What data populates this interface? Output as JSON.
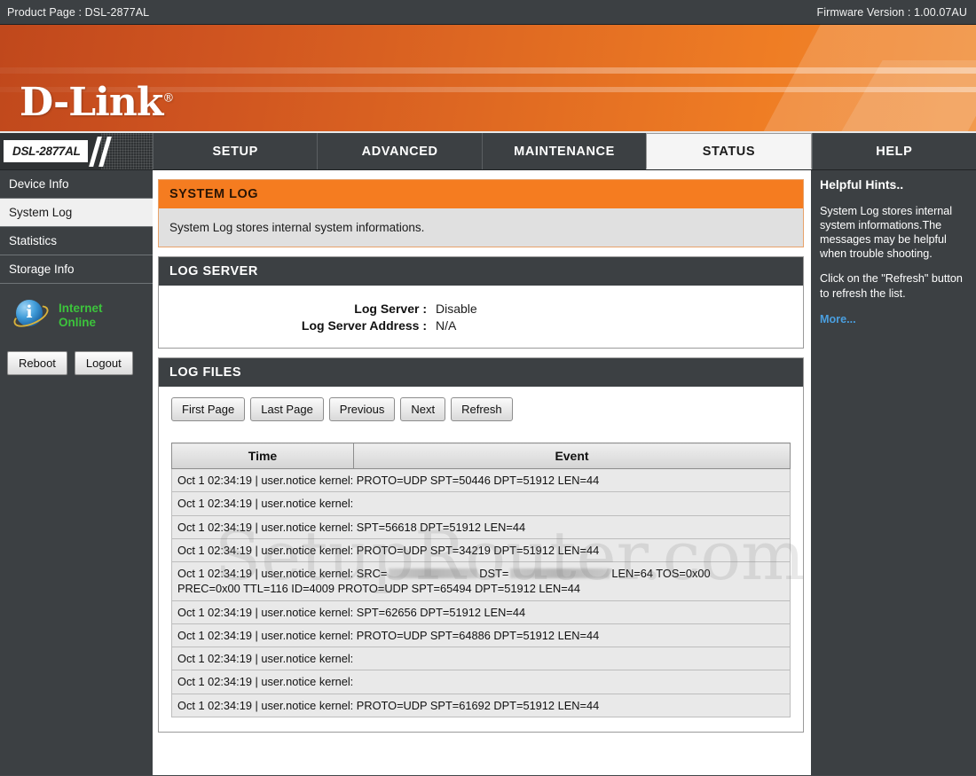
{
  "topbar": {
    "product_page": "Product Page : DSL-2877AL",
    "firmware": "Firmware Version :  1.00.07AU"
  },
  "brand": {
    "logo": "D-Link",
    "registered": "®"
  },
  "nav": {
    "model": "DSL-2877AL",
    "tabs": [
      {
        "label": "SETUP",
        "active": false
      },
      {
        "label": "ADVANCED",
        "active": false
      },
      {
        "label": "MAINTENANCE",
        "active": false
      },
      {
        "label": "STATUS",
        "active": true
      },
      {
        "label": "HELP",
        "active": false
      }
    ]
  },
  "sidebar": {
    "items": [
      {
        "label": "Device Info",
        "active": false
      },
      {
        "label": "System Log",
        "active": true
      },
      {
        "label": "Statistics",
        "active": false
      },
      {
        "label": "Storage Info",
        "active": false
      }
    ],
    "status": {
      "line1": "Internet",
      "line2": "Online",
      "icon": "internet-globe-icon"
    },
    "buttons": {
      "reboot": "Reboot",
      "logout": "Logout"
    }
  },
  "main": {
    "system_log": {
      "title": "SYSTEM LOG",
      "description": "System Log stores internal system informations."
    },
    "log_server": {
      "title": "LOG SERVER",
      "rows": [
        {
          "key": "Log Server :",
          "value": "Disable"
        },
        {
          "key": "Log Server Address :",
          "value": "N/A"
        }
      ]
    },
    "log_files": {
      "title": "LOG FILES",
      "buttons": [
        "First Page",
        "Last Page",
        "Previous",
        "Next",
        "Refresh"
      ],
      "columns": [
        "Time",
        "Event"
      ],
      "rows": [
        {
          "text": "Oct 1 02:34:19 | user.notice kernel: PROTO=UDP SPT=50446 DPT=51912 LEN=44",
          "redacted": false
        },
        {
          "text": "Oct 1 02:34:19 | user.notice kernel:",
          "redacted": false
        },
        {
          "text": "Oct 1 02:34:19 | user.notice kernel: SPT=56618 DPT=51912 LEN=44",
          "redacted": false
        },
        {
          "text": "Oct 1 02:34:19 | user.notice kernel: PROTO=UDP SPT=34219 DPT=51912 LEN=44",
          "redacted": false
        },
        {
          "redacted": true,
          "prefix": "Oct 1 02:34:19 | user.notice kernel: SRC=",
          "middle": "DST=",
          "suffix": "LEN=64 TOS=0x00",
          "line2": "PREC=0x00 TTL=116 ID=4009 PROTO=UDP SPT=65494 DPT=51912 LEN=44"
        },
        {
          "text": "Oct 1 02:34:19 | user.notice kernel: SPT=62656 DPT=51912 LEN=44",
          "redacted": false
        },
        {
          "text": "Oct 1 02:34:19 | user.notice kernel: PROTO=UDP SPT=64886 DPT=51912 LEN=44",
          "redacted": false
        },
        {
          "text": "Oct 1 02:34:19 | user.notice kernel:",
          "redacted": false
        },
        {
          "text": "Oct 1 02:34:19 | user.notice kernel:",
          "redacted": false
        },
        {
          "text": "Oct 1 02:34:19 | user.notice kernel: PROTO=UDP SPT=61692 DPT=51912 LEN=44",
          "redacted": false
        }
      ]
    }
  },
  "hints": {
    "title": "Helpful Hints..",
    "paragraph1": "System Log stores internal system informations.The messages may be helpful when trouble shooting.",
    "paragraph2": "Click on the \"Refresh\" button to refresh the list.",
    "more": "More..."
  },
  "watermark": {
    "text": "SetupRouter.com"
  },
  "colors": {
    "accent_orange": "#f57c20",
    "dark_panel": "#3c4043",
    "status_green": "#3cc43c",
    "link_blue": "#4a9fe0"
  }
}
